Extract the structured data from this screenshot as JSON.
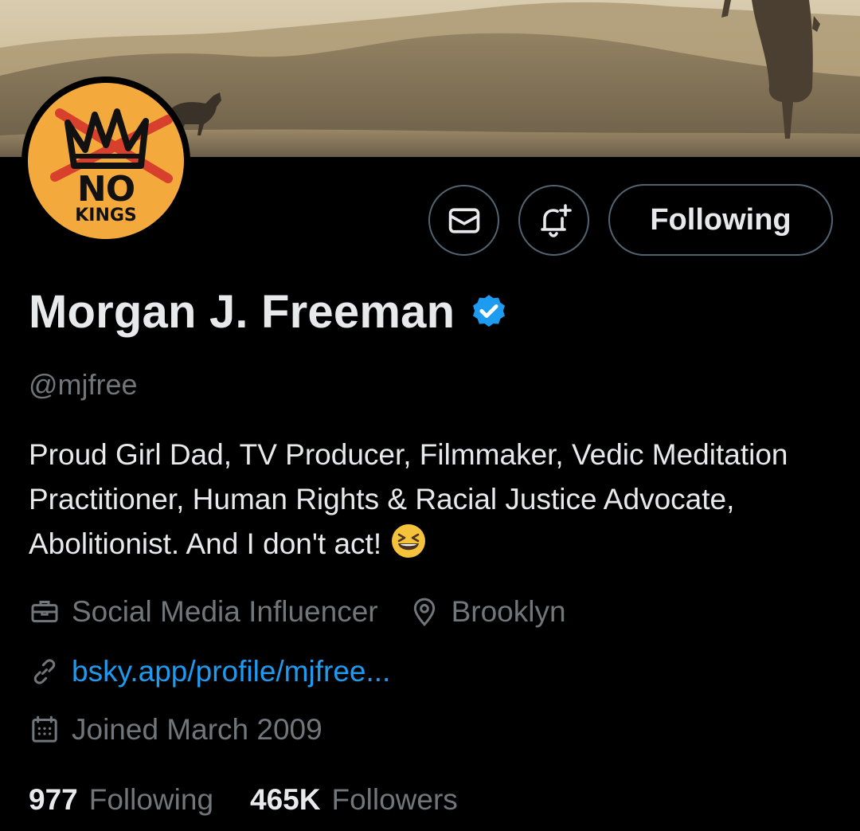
{
  "banner": {
    "description": "banner-photo"
  },
  "avatar": {
    "line1": "NO",
    "line2": "KINGS"
  },
  "actions": {
    "message_icon": "mail-icon",
    "notify_icon": "bell-plus-icon",
    "following_label": "Following"
  },
  "profile": {
    "display_name": "Morgan J. Freeman",
    "verified_icon": "verified-badge-icon",
    "handle": "@mjfree",
    "bio": "Proud Girl Dad, TV Producer, Filmmaker, Vedic Meditation Practitioner, Human Rights & Racial Justice Advocate, Abolitionist. And I don't act!",
    "bio_emoji": "grinning-squinting-face-emoji",
    "profession": "Social Media Influencer",
    "location": "Brooklyn",
    "website": "bsky.app/profile/mjfree...",
    "joined": "Joined March 2009"
  },
  "stats": {
    "following_count": "977",
    "following_label": "Following",
    "followers_count": "465K",
    "followers_label": "Followers"
  },
  "colors": {
    "background": "#000000",
    "text_primary": "#e7e9ea",
    "text_secondary": "#71767b",
    "link": "#1d9bf0",
    "verified": "#1d9bf0",
    "border": "#536471",
    "avatar_bg": "#f4a93d"
  }
}
